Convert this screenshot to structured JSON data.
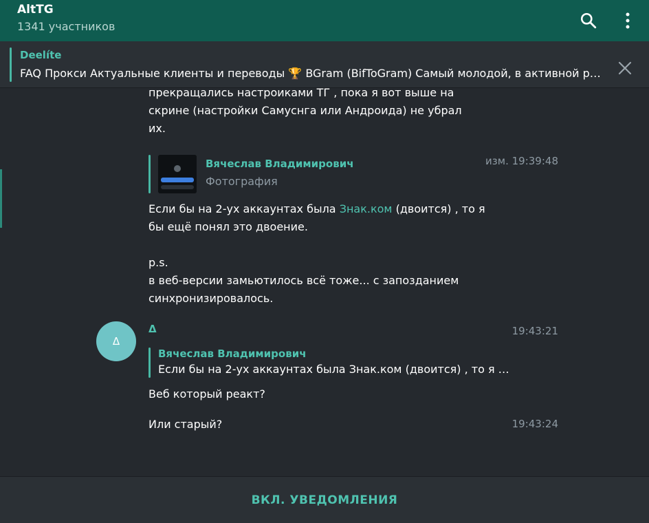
{
  "header": {
    "title": "AltTG",
    "subtitle": "1341 участников",
    "search_icon": "search-icon",
    "menu_icon": "more-vertical-icon"
  },
  "pinned": {
    "name": "Deelíte",
    "text": "FAQ Прокси Актуальные клиенты и переводы 🏆 BGram (BifToGram) Самый молодой, в активной р…",
    "close_icon": "close-icon"
  },
  "messages": {
    "top_text": {
      "line1": "прекращались настроиками ТГ , пока я вот выше на",
      "line2": "скрине (настройки Самуснга или Андроида) не убрал",
      "line3": "их."
    },
    "m1": {
      "reply_name": "Вячеслав Владимирович",
      "reply_sub": "Фотография",
      "time": "изм. 19:39:48",
      "line1_pre": "Если бы на 2-ух аккаунтах была ",
      "line1_link": "Знак.ком",
      "line1_post": " (двоится) , то я",
      "line2": "бы ещё понял это двоение.",
      "line3": "p.s.",
      "line4": "в веб-версии замьютилось всё тоже... с запозданием",
      "line5": "синхронизировалось."
    },
    "m2": {
      "avatar_letter": "Δ",
      "sender": "Δ",
      "time": "19:43:21",
      "reply_name": "Вячеслав Владимирович",
      "reply_text": "Если бы на 2-ух аккаунтах была Знак.ком (двоится) , то я …",
      "text": "Веб который реакт?"
    },
    "m3": {
      "text": "Или старый?",
      "time": "19:43:24"
    }
  },
  "footer": {
    "notify_label": "ВКЛ. УВЕДОМЛЕНИЯ"
  },
  "colors": {
    "header_bg": "#0f5c50",
    "accent": "#4fc3b0",
    "chat_bg": "#25292e",
    "avatar_bg": "#6fc4c6"
  }
}
